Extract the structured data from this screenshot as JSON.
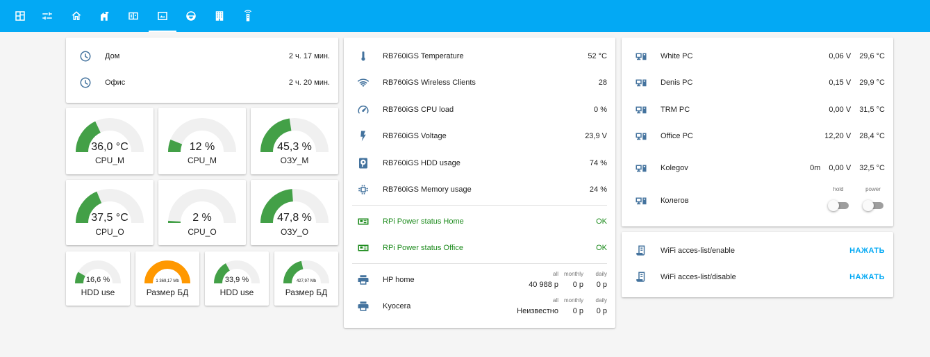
{
  "topbar": {
    "tabs": [
      {
        "icon": "floorplan-icon"
      },
      {
        "icon": "tune-sliders-icon"
      },
      {
        "icon": "home-icon"
      },
      {
        "icon": "home-automation-icon"
      },
      {
        "icon": "meter-panel-icon"
      },
      {
        "icon": "monitor-dashboard-icon"
      },
      {
        "icon": "robot-vacuum-icon"
      },
      {
        "icon": "office-building-icon"
      },
      {
        "icon": "remote-icon"
      }
    ],
    "active_index": 5
  },
  "uptime": [
    {
      "icon": "clock-icon",
      "name": "Дом",
      "state": "2 ч. 17 мин."
    },
    {
      "icon": "clock-icon",
      "name": "Офис",
      "state": "2 ч. 20 мин."
    }
  ],
  "gauges_row1": [
    {
      "value": "36,0 °C",
      "label": "CPU_M",
      "fraction": 0.36,
      "color": "#43a047"
    },
    {
      "value": "12 %",
      "label": "CPU_M",
      "fraction": 0.12,
      "color": "#43a047"
    },
    {
      "value": "45,3 %",
      "label": "ОЗУ_М",
      "fraction": 0.453,
      "color": "#43a047"
    }
  ],
  "gauges_row2": [
    {
      "value": "37,5 °C",
      "label": "CPU_O",
      "fraction": 0.375,
      "color": "#43a047"
    },
    {
      "value": "2 %",
      "label": "CPU_O",
      "fraction": 0.02,
      "color": "#43a047"
    },
    {
      "value": "47,8 %",
      "label": "ОЗУ_О",
      "fraction": 0.478,
      "color": "#43a047"
    }
  ],
  "gauges_row3": [
    {
      "value": "16,6 %",
      "label": "HDD use",
      "fraction": 0.166,
      "color": "#43a047"
    },
    {
      "value": "1 369,17 Mb",
      "label": "Размер БД",
      "fraction": 1.0,
      "color": "#ff9800"
    },
    {
      "value": "33,9 %",
      "label": "HDD use",
      "fraction": 0.339,
      "color": "#43a047"
    },
    {
      "value": "427,97 Mb",
      "label": "Размер БД",
      "fraction": 0.43,
      "color": "#43a047"
    }
  ],
  "router": [
    {
      "icon": "thermometer-icon",
      "name": "RB760iGS Temperature",
      "state": "52 °C"
    },
    {
      "icon": "wifi-icon",
      "name": "RB760iGS Wireless Clients",
      "state": "28"
    },
    {
      "icon": "speedometer-icon",
      "name": "RB760iGS CPU load",
      "state": "0 %"
    },
    {
      "icon": "flash-icon",
      "name": "RB760iGS Voltage",
      "state": "23,9 V"
    },
    {
      "icon": "harddisk-icon",
      "name": "RB760iGS HDD usage",
      "state": "74 %"
    },
    {
      "icon": "chip-icon",
      "name": "RB760iGS Memory usage",
      "state": "24 %"
    }
  ],
  "rpi": [
    {
      "icon": "raspberry-board-icon",
      "name": "RPi Power status Home",
      "state": "OK"
    },
    {
      "icon": "raspberry-board-icon",
      "name": "RPi Power status Office",
      "state": "OK"
    }
  ],
  "printers": [
    {
      "icon": "printer-icon",
      "name": "HP home",
      "all_label": "all",
      "all": "40 988 р",
      "monthly_label": "monthly",
      "monthly": "0 р",
      "daily_label": "daily",
      "daily": "0 р"
    },
    {
      "icon": "printer-icon",
      "name": "Kyocera",
      "all_label": "all",
      "all": "Неизвестно",
      "monthly_label": "monthly",
      "monthly": "0 р",
      "daily_label": "daily",
      "daily": "0 р"
    }
  ],
  "pcs": [
    {
      "icon": "desktop-tower-monitor-icon",
      "name": "White PC",
      "voltage": "0,06 V",
      "temp": "29,6 °C"
    },
    {
      "icon": "desktop-tower-monitor-icon",
      "name": "Denis PC",
      "voltage": "0,15 V",
      "temp": "29,9 °C"
    },
    {
      "icon": "desktop-tower-monitor-icon",
      "name": "TRM PC",
      "voltage": "0,00 V",
      "temp": "31,5 °C"
    },
    {
      "icon": "desktop-tower-monitor-icon",
      "name": "Office PC",
      "voltage": "12,20 V",
      "temp": "28,4 °C"
    },
    {
      "icon": "desktop-tower-monitor-icon",
      "name": "Kolegov",
      "extra": "0m",
      "voltage": "0,00 V",
      "temp": "32,5 °C"
    }
  ],
  "kolegov": {
    "icon": "desktop-tower-monitor-icon",
    "name": "Колегов",
    "hold_label": "hold",
    "power_label": "power",
    "hold_on": false,
    "power_on": false
  },
  "wifi_scripts": [
    {
      "icon": "script-text-icon",
      "name": "WiFi acces-list/enable",
      "action": "НАЖАТЬ"
    },
    {
      "icon": "script-text-icon",
      "name": "WiFi acces-list/disable",
      "action": "НАЖАТЬ"
    }
  ],
  "colors": {
    "accent": "#03a9f4",
    "icon": "#44739e",
    "ok_green": "#1b8a1b",
    "gauge_green": "#43a047",
    "gauge_orange": "#ff9800"
  }
}
